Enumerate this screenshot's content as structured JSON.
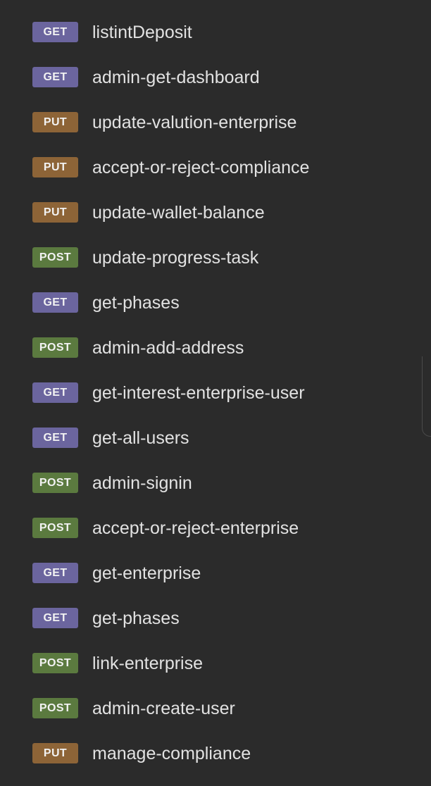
{
  "requests": [
    {
      "method": "GET",
      "name": "listintDeposit",
      "color": "#6b659e"
    },
    {
      "method": "GET",
      "name": "admin-get-dashboard",
      "color": "#6b659e"
    },
    {
      "method": "PUT",
      "name": "update-valution-enterprise",
      "color": "#8d6437"
    },
    {
      "method": "PUT",
      "name": "accept-or-reject-compliance",
      "color": "#8d6437"
    },
    {
      "method": "PUT",
      "name": "update-wallet-balance",
      "color": "#8d6437"
    },
    {
      "method": "POST",
      "name": "update-progress-task",
      "color": "#5b7a3f"
    },
    {
      "method": "GET",
      "name": "get-phases",
      "color": "#6b659e"
    },
    {
      "method": "POST",
      "name": "admin-add-address",
      "color": "#5b7a3f"
    },
    {
      "method": "GET",
      "name": "get-interest-enterprise-user",
      "color": "#6b659e"
    },
    {
      "method": "GET",
      "name": "get-all-users",
      "color": "#6b659e"
    },
    {
      "method": "POST",
      "name": "admin-signin",
      "color": "#5b7a3f"
    },
    {
      "method": "POST",
      "name": "accept-or-reject-enterprise",
      "color": "#5b7a3f"
    },
    {
      "method": "GET",
      "name": "get-enterprise",
      "color": "#6b659e"
    },
    {
      "method": "GET",
      "name": "get-phases",
      "color": "#6b659e"
    },
    {
      "method": "POST",
      "name": "link-enterprise",
      "color": "#5b7a3f"
    },
    {
      "method": "POST",
      "name": "admin-create-user",
      "color": "#5b7a3f"
    },
    {
      "method": "PUT",
      "name": "manage-compliance",
      "color": "#8d6437"
    }
  ]
}
